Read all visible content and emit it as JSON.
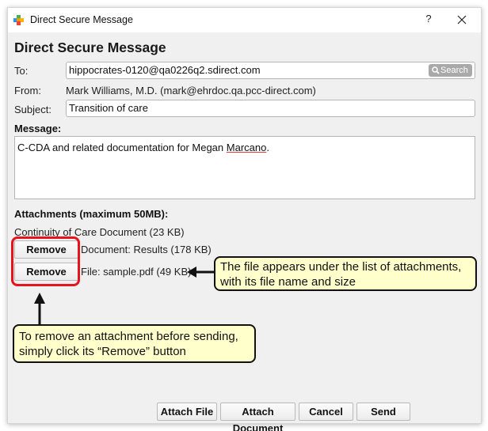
{
  "window": {
    "title": "Direct Secure Message",
    "app_icon": "plus-logo-icon",
    "help_label": "?",
    "close_icon": "close-icon"
  },
  "form": {
    "heading": "Direct Secure Message",
    "to_label": "To:",
    "to_value": "hippocrates-0120@qa0226q2.sdirect.com",
    "search_label": "Search",
    "search_icon": "search-icon",
    "from_label": "From:",
    "from_value": "Mark Williams, M.D. (mark@ehrdoc.qa.pcc-direct.com)",
    "subject_label": "Subject:",
    "subject_value": "Transition of care",
    "message_label": "Message:",
    "message_text_before": "C-CDA and related documentation for Megan ",
    "message_text_misspelled": "Marcano",
    "message_text_after": "."
  },
  "attachments": {
    "heading": "Attachments (maximum 50MB):",
    "items": [
      {
        "label": "Continuity of Care Document (23 KB)",
        "removable": false
      },
      {
        "label": "Document: Results (178 KB)",
        "removable": true,
        "remove_label": "Remove"
      },
      {
        "label": "File: sample.pdf (49 KB)",
        "removable": true,
        "remove_label": "Remove"
      }
    ]
  },
  "annotations": {
    "file_callout": "The file appears under the list of attachments, with its file name and size",
    "remove_callout": "To remove an attachment before sending, simply click its “Remove” button",
    "highlight_color": "#e8141c",
    "callout_bg": "#ffffcc"
  },
  "footer": {
    "attach_file": "Attach File",
    "attach_document": "Attach Document",
    "cancel": "Cancel",
    "send": "Send"
  }
}
